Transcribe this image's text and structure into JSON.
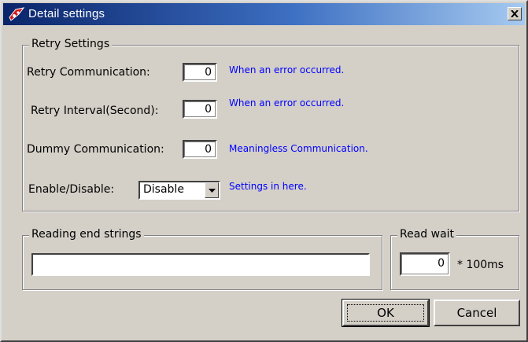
{
  "window": {
    "title": "Detail settings"
  },
  "retry_settings": {
    "legend": "Retry Settings",
    "rows": [
      {
        "label": "Retry Communication:",
        "value": "0",
        "hint": "When an error occurred."
      },
      {
        "label": "Retry Interval(Second):",
        "value": "0",
        "hint": "When an error occurred."
      },
      {
        "label": "Dummy Communication:",
        "value": "0",
        "hint": "Meaningless Communication."
      }
    ],
    "enable": {
      "label": "Enable/Disable:",
      "selected": "Disable",
      "hint": "Settings in here."
    }
  },
  "reading_end": {
    "legend": "Reading end strings",
    "value": ""
  },
  "read_wait": {
    "legend": "Read wait",
    "value": "0",
    "unit": "* 100ms"
  },
  "buttons": {
    "ok": "OK",
    "cancel": "Cancel"
  },
  "colors": {
    "face": "#d4d0c8",
    "title_start": "#0a246a",
    "title_end": "#a6caf0",
    "hint": "#0000ff"
  }
}
